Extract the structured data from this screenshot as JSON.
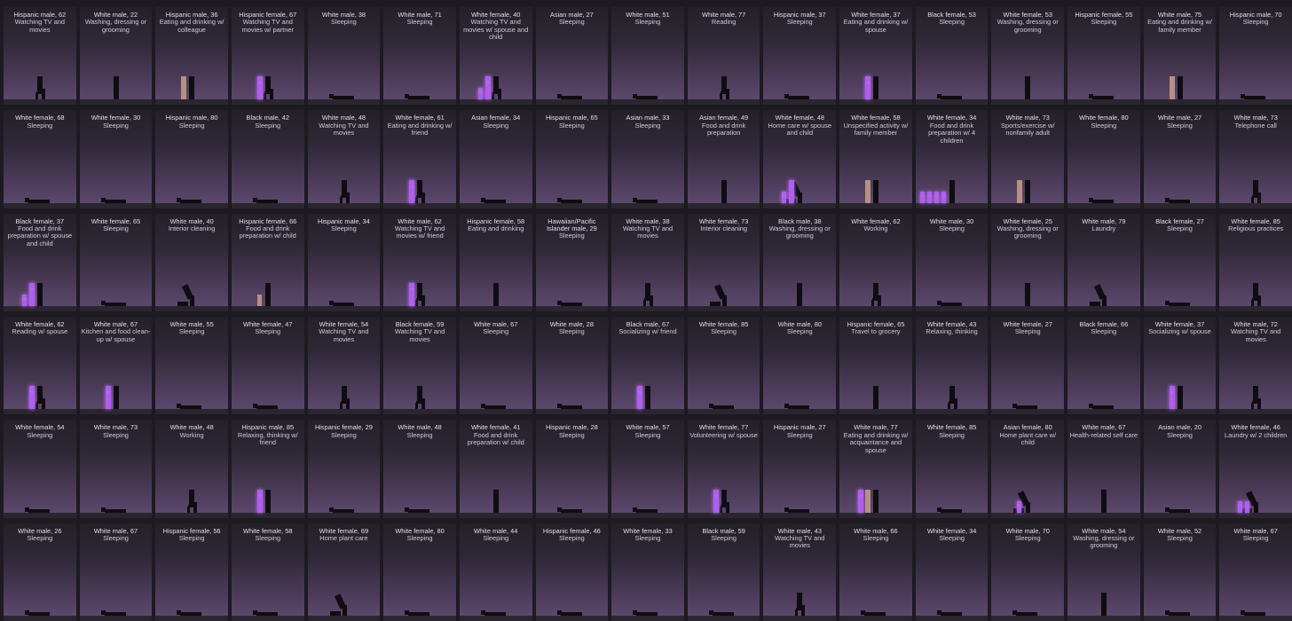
{
  "figure_colors": {
    "dark": "#0f0d12",
    "glow": "#b05df0",
    "tan": "#b89082"
  },
  "cells": [
    {
      "who": "Hispanic male, 62",
      "act": "Watching TV and movies",
      "pose": "sit"
    },
    {
      "who": "White male, 22",
      "act": "Washing, dressing or grooming",
      "pose": "stand"
    },
    {
      "who": "Hispanic male, 36",
      "act": "Eating and drinking w/ colleague",
      "pose": "stand",
      "companions": [
        "tan"
      ]
    },
    {
      "who": "Hispanic female, 67",
      "act": "Watching TV and movies w/ partner",
      "pose": "sit",
      "companions": [
        "glow"
      ]
    },
    {
      "who": "White male, 38",
      "act": "Sleeping",
      "pose": "lie"
    },
    {
      "who": "White male, 71",
      "act": "Sleeping",
      "pose": "lie"
    },
    {
      "who": "White female, 40",
      "act": "Watching TV and movies w/ spouse and child",
      "pose": "sit",
      "companions": [
        "glow",
        "glow-small"
      ]
    },
    {
      "who": "Asian male, 27",
      "act": "Sleeping",
      "pose": "lie"
    },
    {
      "who": "White male, 51",
      "act": "Sleeping",
      "pose": "lie"
    },
    {
      "who": "White male, 77",
      "act": "Reading",
      "pose": "sit"
    },
    {
      "who": "Hispanic male, 37",
      "act": "Sleeping",
      "pose": "lie"
    },
    {
      "who": "White female, 37",
      "act": "Eating and drinking w/ spouse",
      "pose": "stand",
      "companions": [
        "glow"
      ]
    },
    {
      "who": "Black female, 53",
      "act": "Sleeping",
      "pose": "lie"
    },
    {
      "who": "White female, 53",
      "act": "Washing, dressing or grooming",
      "pose": "stand"
    },
    {
      "who": "Hispanic female, 55",
      "act": "Sleeping",
      "pose": "lie"
    },
    {
      "who": "White male, 75",
      "act": "Eating and drinking w/ family member",
      "pose": "stand",
      "companions": [
        "tan"
      ]
    },
    {
      "who": "Hispanic male, 70",
      "act": "Sleeping",
      "pose": "lie"
    },
    {
      "who": "White female, 68",
      "act": "Sleeping",
      "pose": "lie"
    },
    {
      "who": "White female, 30",
      "act": "Sleeping",
      "pose": "lie"
    },
    {
      "who": "Hispanic male, 80",
      "act": "Sleeping",
      "pose": "lie"
    },
    {
      "who": "Black male, 42",
      "act": "Sleeping",
      "pose": "lie"
    },
    {
      "who": "White male, 48",
      "act": "Watching TV and movies",
      "pose": "sit"
    },
    {
      "who": "White female, 61",
      "act": "Eating and drinking w/ friend",
      "pose": "sit",
      "companions": [
        "glow"
      ]
    },
    {
      "who": "Asian female, 34",
      "act": "Sleeping",
      "pose": "lie"
    },
    {
      "who": "Hispanic male, 65",
      "act": "Sleeping",
      "pose": "lie"
    },
    {
      "who": "Asian male, 33",
      "act": "Sleeping",
      "pose": "lie"
    },
    {
      "who": "Asian female, 49",
      "act": "Food and drink preparation",
      "pose": "stand"
    },
    {
      "who": "White female, 48",
      "act": "Home care w/ spouse and child",
      "pose": "bend",
      "companions": [
        "glow",
        "glow-small"
      ]
    },
    {
      "who": "White female, 58",
      "act": "Unspecified activity w/ family member",
      "pose": "stand",
      "companions": [
        "tan"
      ]
    },
    {
      "who": "White female, 34",
      "act": "Food and drink preparation w/ 4 children",
      "pose": "stand",
      "companions": [
        "glow-small",
        "glow-small",
        "glow-small",
        "glow-small"
      ]
    },
    {
      "who": "White male, 73",
      "act": "Sports/exercise w/ nonfamily adult",
      "pose": "stand",
      "companions": [
        "tan"
      ]
    },
    {
      "who": "White female, 80",
      "act": "Sleeping",
      "pose": "lie"
    },
    {
      "who": "White male, 27",
      "act": "Sleeping",
      "pose": "lie"
    },
    {
      "who": "White male, 73",
      "act": "Telephone call",
      "pose": "sit"
    },
    {
      "who": "Black female, 37",
      "act": "Food and drink preparation w/ spouse and child",
      "pose": "stand",
      "companions": [
        "glow",
        "glow-small"
      ]
    },
    {
      "who": "White female, 65",
      "act": "Sleeping",
      "pose": "lie"
    },
    {
      "who": "White male, 40",
      "act": "Interior cleaning",
      "pose": "bend"
    },
    {
      "who": "Hispanic female, 66",
      "act": "Food and drink preparation w/ child",
      "pose": "stand",
      "companions": [
        "tan-small"
      ]
    },
    {
      "who": "Hispanic male, 34",
      "act": "Sleeping",
      "pose": "lie"
    },
    {
      "who": "White male, 62",
      "act": "Watching TV and movies w/ friend",
      "pose": "sit",
      "companions": [
        "glow"
      ]
    },
    {
      "who": "Hispanic female, 58",
      "act": "Eating and drinking",
      "pose": "stand"
    },
    {
      "who": "Hawaiian/Pacific Islander male, 29",
      "act": "Sleeping",
      "pose": "lie"
    },
    {
      "who": "White male, 38",
      "act": "Watching TV and movies",
      "pose": "sit"
    },
    {
      "who": "White female, 73",
      "act": "Interior cleaning",
      "pose": "bend"
    },
    {
      "who": "Black male, 38",
      "act": "Washing, dressing or grooming",
      "pose": "stand"
    },
    {
      "who": "White female, 62",
      "act": "Working",
      "pose": "sit"
    },
    {
      "who": "White male, 30",
      "act": "Sleeping",
      "pose": "lie"
    },
    {
      "who": "White female, 25",
      "act": "Washing, dressing or grooming",
      "pose": "stand"
    },
    {
      "who": "White male, 79",
      "act": "Laundry",
      "pose": "bend"
    },
    {
      "who": "Black female, 27",
      "act": "Sleeping",
      "pose": "lie"
    },
    {
      "who": "White female, 85",
      "act": "Religious practices",
      "pose": "sit"
    },
    {
      "who": "White female, 62",
      "act": "Reading w/ spouse",
      "pose": "sit",
      "companions": [
        "glow"
      ]
    },
    {
      "who": "White male, 67",
      "act": "Kitchen and food clean-up w/ spouse",
      "pose": "stand",
      "companions": [
        "glow"
      ]
    },
    {
      "who": "White male, 55",
      "act": "Sleeping",
      "pose": "lie"
    },
    {
      "who": "White female, 47",
      "act": "Sleeping",
      "pose": "lie"
    },
    {
      "who": "White female, 54",
      "act": "Watching TV and movies",
      "pose": "sit"
    },
    {
      "who": "Black female, 59",
      "act": "Watching TV and movies",
      "pose": "sit"
    },
    {
      "who": "White male, 67",
      "act": "Sleeping",
      "pose": "lie"
    },
    {
      "who": "White male, 28",
      "act": "Sleeping",
      "pose": "lie"
    },
    {
      "who": "Black male, 67",
      "act": "Socializing w/ friend",
      "pose": "stand",
      "companions": [
        "glow"
      ]
    },
    {
      "who": "White female, 85",
      "act": "Sleeping",
      "pose": "lie"
    },
    {
      "who": "White male, 80",
      "act": "Sleeping",
      "pose": "lie"
    },
    {
      "who": "Hispanic female, 65",
      "act": "Travel to grocery",
      "pose": "stand"
    },
    {
      "who": "White female, 43",
      "act": "Relaxing, thinking",
      "pose": "sit"
    },
    {
      "who": "White female, 27",
      "act": "Sleeping",
      "pose": "lie"
    },
    {
      "who": "Black female, 66",
      "act": "Sleeping",
      "pose": "lie"
    },
    {
      "who": "White female, 37",
      "act": "Socializing w/ spouse",
      "pose": "stand",
      "companions": [
        "glow"
      ]
    },
    {
      "who": "White male, 72",
      "act": "Watching TV and movies",
      "pose": "sit"
    },
    {
      "who": "White female, 54",
      "act": "Sleeping",
      "pose": "lie"
    },
    {
      "who": "White male, 73",
      "act": "Sleeping",
      "pose": "lie"
    },
    {
      "who": "White male, 48",
      "act": "Working",
      "pose": "sit"
    },
    {
      "who": "Hispanic male, 85",
      "act": "Relaxing, thinking w/ friend",
      "pose": "stand",
      "companions": [
        "glow"
      ]
    },
    {
      "who": "Hispanic female, 29",
      "act": "Sleeping",
      "pose": "lie"
    },
    {
      "who": "White male, 48",
      "act": "Sleeping",
      "pose": "lie"
    },
    {
      "who": "White female, 41",
      "act": "Food and drink preparation w/ child",
      "pose": "stand"
    },
    {
      "who": "Hispanic male, 28",
      "act": "Sleeping",
      "pose": "lie"
    },
    {
      "who": "White male, 57",
      "act": "Sleeping",
      "pose": "lie"
    },
    {
      "who": "White female, 77",
      "act": "Volunteering w/ spouse",
      "pose": "sit",
      "companions": [
        "glow"
      ]
    },
    {
      "who": "Hispanic male, 27",
      "act": "Sleeping",
      "pose": "lie"
    },
    {
      "who": "White male, 77",
      "act": "Eating and drinking w/ acquaintance and spouse",
      "pose": "stand",
      "companions": [
        "tan",
        "glow"
      ]
    },
    {
      "who": "White female, 85",
      "act": "Sleeping",
      "pose": "lie"
    },
    {
      "who": "Asian female, 80",
      "act": "Home plant care w/ child",
      "pose": "bend",
      "companions": [
        "glow-small"
      ]
    },
    {
      "who": "White male, 67",
      "act": "Health-related self care",
      "pose": "stand"
    },
    {
      "who": "Asian male, 20",
      "act": "Sleeping",
      "pose": "lie"
    },
    {
      "who": "White female, 46",
      "act": "Laundry w/ 2 children",
      "pose": "bend",
      "companions": [
        "glow-small",
        "glow-small"
      ]
    },
    {
      "who": "White male, 26",
      "act": "Sleeping",
      "pose": "lie"
    },
    {
      "who": "White male, 67",
      "act": "Sleeping",
      "pose": "lie"
    },
    {
      "who": "Hispanic female, 56",
      "act": "Sleeping",
      "pose": "lie"
    },
    {
      "who": "White female, 58",
      "act": "Sleeping",
      "pose": "lie"
    },
    {
      "who": "White female, 69",
      "act": "Home plant care",
      "pose": "bend"
    },
    {
      "who": "White female, 80",
      "act": "Sleeping",
      "pose": "lie"
    },
    {
      "who": "White male, 44",
      "act": "Sleeping",
      "pose": "lie"
    },
    {
      "who": "Hispanic female, 46",
      "act": "Sleeping",
      "pose": "lie"
    },
    {
      "who": "White female, 33",
      "act": "Sleeping",
      "pose": "lie"
    },
    {
      "who": "Black male, 59",
      "act": "Sleeping",
      "pose": "lie"
    },
    {
      "who": "White male, 43",
      "act": "Watching TV and movies",
      "pose": "sit"
    },
    {
      "who": "White male, 66",
      "act": "Sleeping",
      "pose": "lie"
    },
    {
      "who": "White female, 34",
      "act": "Sleeping",
      "pose": "lie"
    },
    {
      "who": "White male, 70",
      "act": "Sleeping",
      "pose": "lie"
    },
    {
      "who": "White male, 54",
      "act": "Washing, dressing or grooming",
      "pose": "stand"
    },
    {
      "who": "White male, 52",
      "act": "Sleeping",
      "pose": "lie"
    },
    {
      "who": "White male, 67",
      "act": "Sleeping",
      "pose": "lie"
    }
  ]
}
